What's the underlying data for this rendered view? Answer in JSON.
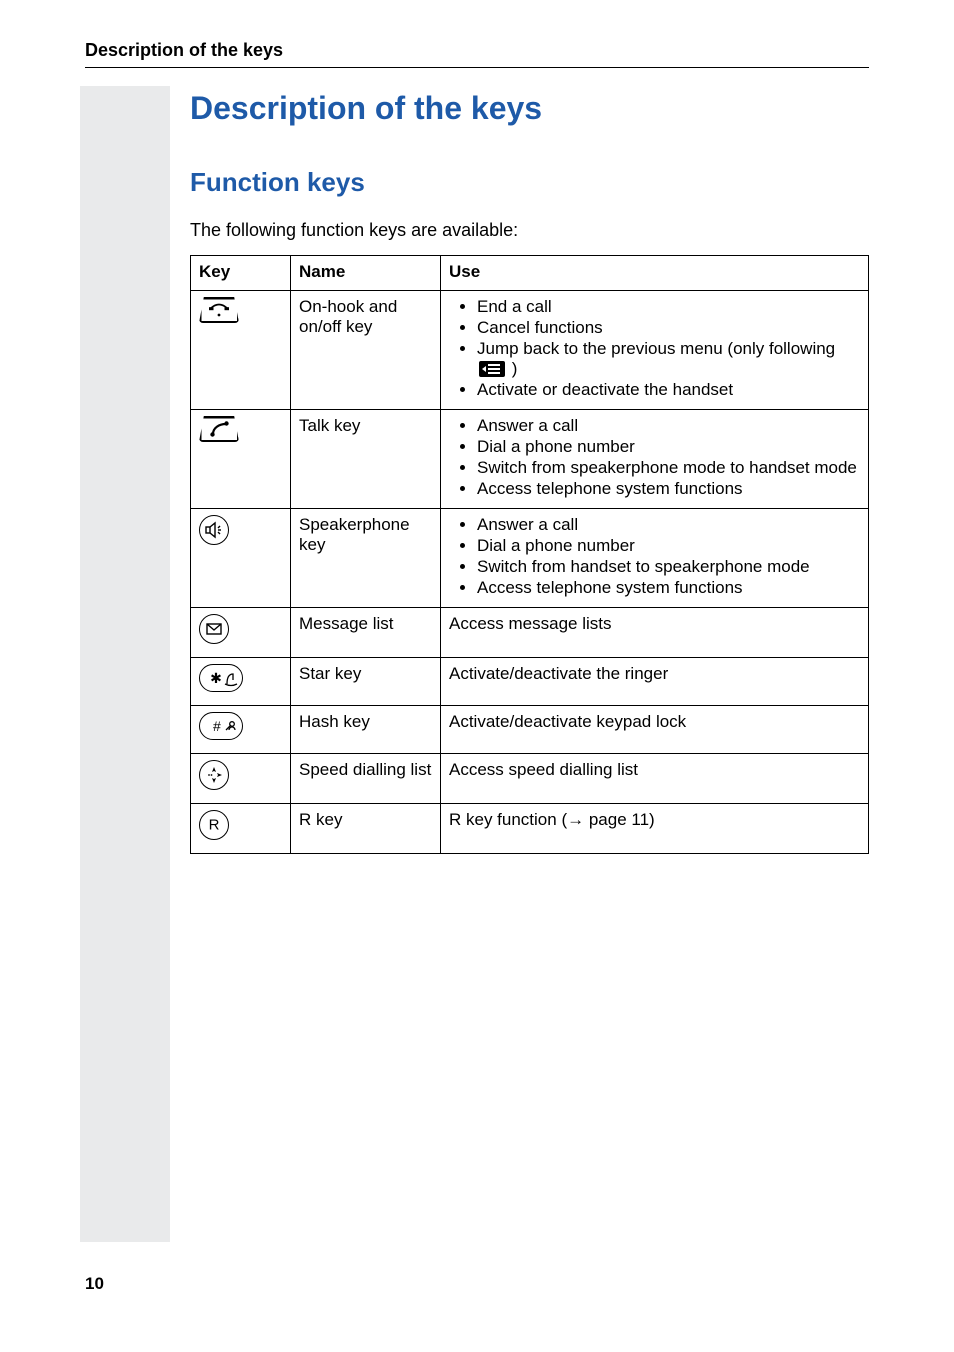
{
  "header": "Description of the keys",
  "title": "Description of the keys",
  "section": "Function keys",
  "intro": "The following function keys are available:",
  "columns": {
    "key": "Key",
    "name": "Name",
    "use": "Use"
  },
  "rows": [
    {
      "icon": "on-hook",
      "name": "On-hook and on/off key",
      "use": [
        "End a call",
        "Cancel functions",
        {
          "pre": "Jump back to the previous menu (only following ",
          "chip": true,
          "post": " )"
        },
        "Activate or deactivate the handset"
      ]
    },
    {
      "icon": "talk",
      "name": "Talk key",
      "use": [
        "Answer a call",
        "Dial a phone number",
        "Switch from speakerphone mode to handset mode",
        "Access telephone system functions"
      ]
    },
    {
      "icon": "speaker",
      "name": "Speakerphone key",
      "use": [
        "Answer a call",
        "Dial a phone number",
        "Switch from handset to speakerphone mode",
        "Access telephone system functions"
      ]
    },
    {
      "icon": "message",
      "name": "Message list",
      "use_plain": "Access message lists"
    },
    {
      "icon": "star",
      "name": "Star key",
      "use_plain": "Activate/deactivate the ringer"
    },
    {
      "icon": "hash",
      "name": "Hash key",
      "use_plain": "Activate/deactivate keypad lock"
    },
    {
      "icon": "speeddial",
      "name": "Speed dialling list",
      "use_plain": "Access speed dialling list"
    },
    {
      "icon": "rkey",
      "name": "R key",
      "use_ref": {
        "pre": "R key function (",
        "arrow": "→",
        "mid": " page  ",
        "page": "11",
        "post": ")"
      }
    }
  ],
  "page_number": "10"
}
